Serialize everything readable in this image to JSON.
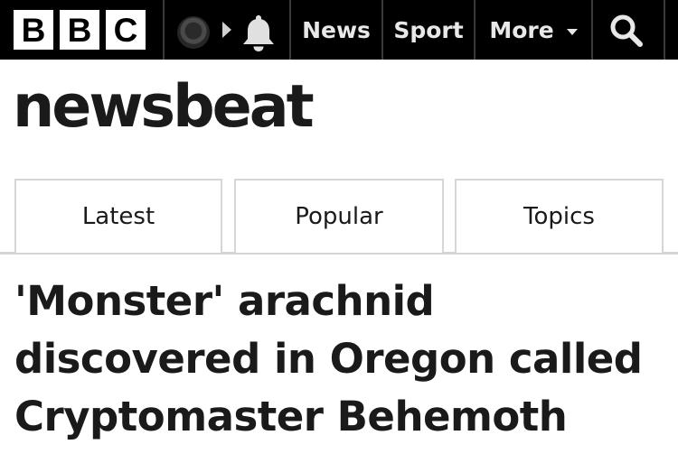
{
  "header": {
    "logo_letters": [
      "B",
      "B",
      "C"
    ],
    "icons": {
      "account": "account-icon",
      "play": "play-icon",
      "notifications": "bell-icon",
      "search": "search-icon"
    },
    "nav": {
      "news": "News",
      "sport": "Sport",
      "more": "More"
    },
    "colors": {
      "bar": "#000000",
      "nav_text": "#e8e8e8"
    }
  },
  "brand": {
    "name": "newsbeat"
  },
  "tabs": [
    {
      "label": "Latest"
    },
    {
      "label": "Popular"
    },
    {
      "label": "Topics"
    }
  ],
  "article": {
    "headline_lines": [
      "'Monster' arachnid",
      "discovered in Oregon called",
      "Cryptomaster Behemoth"
    ]
  }
}
